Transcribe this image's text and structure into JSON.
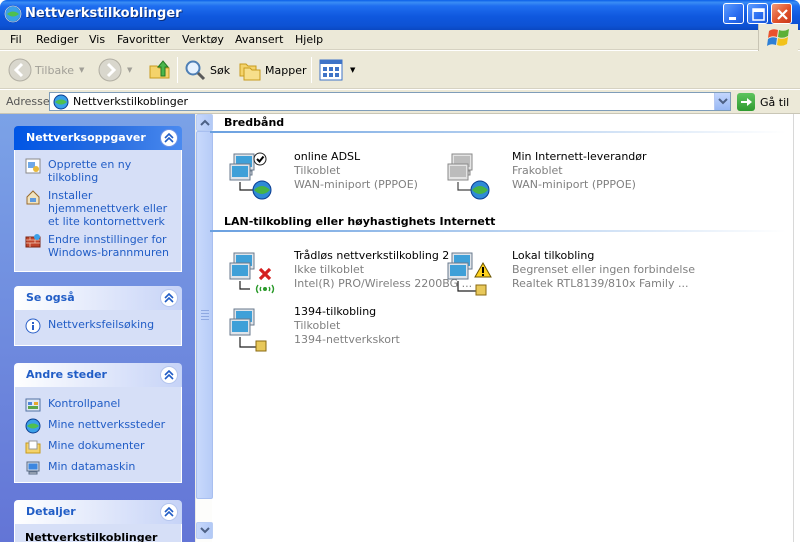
{
  "window": {
    "title": "Nettverkstilkoblinger",
    "icon": "network-connections-icon"
  },
  "menu": [
    "Fil",
    "Rediger",
    "Vis",
    "Favoritter",
    "Verktøy",
    "Avansert",
    "Hjelp"
  ],
  "toolbar": {
    "back": "Tilbake",
    "search": "Søk",
    "folders": "Mapper"
  },
  "address": {
    "label": "Adresse",
    "value": "Nettverkstilkoblinger",
    "go": "Gå til"
  },
  "sidepanel": {
    "tasks": {
      "title": "Nettverksoppgaver",
      "items": [
        {
          "label": "Opprette en ny tilkobling",
          "icon": "new-connection-icon"
        },
        {
          "label": "Installer hjemmenettverk eller et lite kontornettverk",
          "icon": "home-network-icon"
        },
        {
          "label": "Endre innstillinger for Windows-brannmuren",
          "icon": "firewall-icon"
        }
      ]
    },
    "see_also": {
      "title": "Se også",
      "items": [
        {
          "label": "Nettverksfeilsøking",
          "icon": "info-icon"
        }
      ]
    },
    "other_places": {
      "title": "Andre steder",
      "items": [
        {
          "label": "Kontrollpanel",
          "icon": "control-panel-icon"
        },
        {
          "label": "Mine nettverkssteder",
          "icon": "network-places-icon"
        },
        {
          "label": "Mine dokumenter",
          "icon": "my-documents-icon"
        },
        {
          "label": "Min datamaskin",
          "icon": "my-computer-icon"
        }
      ]
    },
    "details": {
      "title": "Detaljer",
      "partial": "Nettverkstilkoblinger"
    }
  },
  "groups": [
    {
      "title": "Bredbånd",
      "connections": [
        {
          "name": "online ADSL",
          "status": "Tilkoblet",
          "device": "WAN-miniport (PPPOE)",
          "badge": "connected-check"
        },
        {
          "name": "Min Internett-leverandør",
          "status": "Frakoblet",
          "device": "WAN-miniport (PPPOE)",
          "badge": "none"
        }
      ]
    },
    {
      "title": "LAN-tilkobling eller høyhastighets Internett",
      "connections": [
        {
          "name": "Trådløs nettverkstilkobling 2",
          "status": "Ikke tilkoblet",
          "device": "Intel(R) PRO/Wireless 2200BG ...",
          "badge": "red-x"
        },
        {
          "name": "Lokal tilkobling",
          "status": "Begrenset eller ingen forbindelse",
          "device": "Realtek RTL8139/810x Family ...",
          "badge": "warning"
        },
        {
          "name": "1394-tilkobling",
          "status": "Tilkoblet",
          "device": "1394-nettverkskort",
          "badge": "none"
        }
      ]
    }
  ],
  "colors": {
    "titlebar": "#0d52d4",
    "taskpane": "#6f8fe0",
    "link": "#215dc6"
  }
}
